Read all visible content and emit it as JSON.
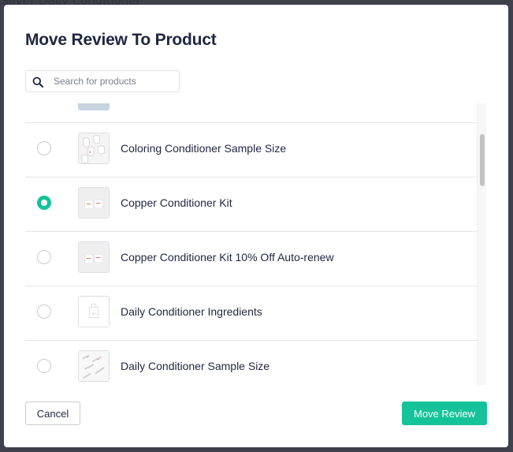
{
  "background": {
    "partial_text": "Silver Daily Conditioner"
  },
  "modal": {
    "title": "Move Review To Product",
    "search": {
      "icon": "search-icon",
      "placeholder": "Search for products",
      "value": ""
    },
    "products": [
      {
        "name": "Coloring Conditioner Sample Size",
        "selected": false,
        "thumbnail": "sample-packets-image"
      },
      {
        "name": "Copper Conditioner Kit",
        "selected": true,
        "thumbnail": "jar-kit-image"
      },
      {
        "name": "Copper Conditioner Kit 10% Off Auto-renew",
        "selected": false,
        "thumbnail": "jar-kit-image"
      },
      {
        "name": "Daily Conditioner Ingredients",
        "selected": false,
        "thumbnail": "bag-placeholder-image"
      },
      {
        "name": "Daily Conditioner Sample Size",
        "selected": false,
        "thumbnail": "sample-tubes-image"
      }
    ],
    "scroll_position": 0.12,
    "cancel_label": "Cancel",
    "confirm_label": "Move Review",
    "accent_color": "#15c39a"
  }
}
